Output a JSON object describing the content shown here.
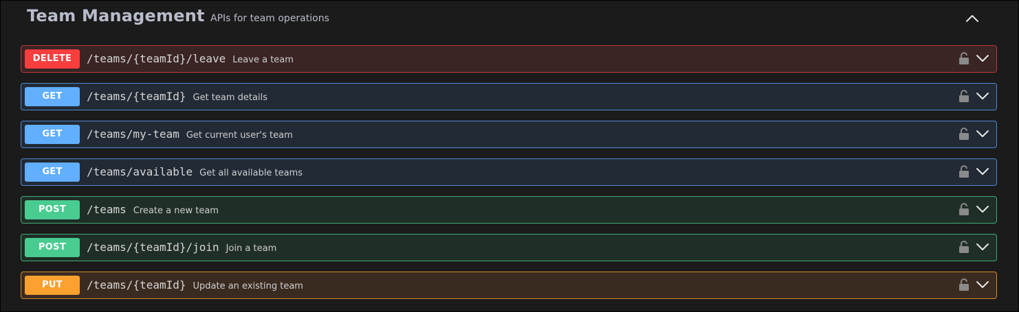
{
  "tag": {
    "title": "Team Management",
    "description": "APIs for team operations"
  },
  "operations": [
    {
      "method": "DELETE",
      "path": "/teams/{teamId}/leave",
      "summary": "Leave a team",
      "kind": "delete"
    },
    {
      "method": "GET",
      "path": "/teams/{teamId}",
      "summary": "Get team details",
      "kind": "get"
    },
    {
      "method": "GET",
      "path": "/teams/my-team",
      "summary": "Get current user's team",
      "kind": "get"
    },
    {
      "method": "GET",
      "path": "/teams/available",
      "summary": "Get all available teams",
      "kind": "get"
    },
    {
      "method": "POST",
      "path": "/teams",
      "summary": "Create a new team",
      "kind": "post"
    },
    {
      "method": "POST",
      "path": "/teams/{teamId}/join",
      "summary": "Join a team",
      "kind": "post"
    },
    {
      "method": "PUT",
      "path": "/teams/{teamId}",
      "summary": "Update an existing team",
      "kind": "put"
    }
  ],
  "icons": {
    "lock": "lock-icon",
    "expand": "chevron-down-icon",
    "collapse": "chevron-up-icon"
  },
  "colors": {
    "delete": "#f93e3e",
    "get": "#61affe",
    "post": "#49cc90",
    "put": "#fca130"
  }
}
